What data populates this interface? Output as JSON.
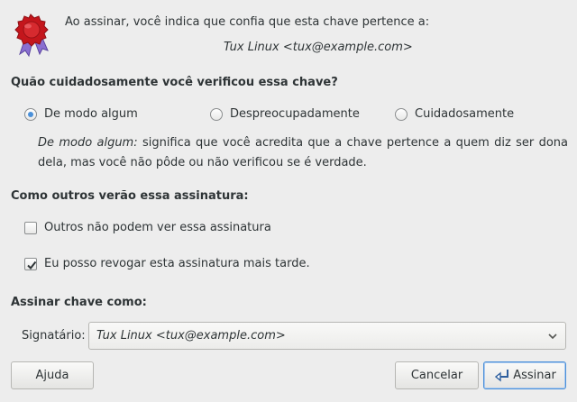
{
  "header": {
    "intro_text": "Ao assinar, você indica que confia que esta chave pertence a:",
    "key_owner": "Tux Linux <tux@example.com>"
  },
  "verification": {
    "heading": "Quão cuidadosamente você verificou essa chave?",
    "options": [
      {
        "label": "De modo algum",
        "selected": true
      },
      {
        "label": "Despreocupadamente",
        "selected": false
      },
      {
        "label": "Cuidadosamente",
        "selected": false
      }
    ],
    "description_term": "De modo algum:",
    "description_text": " significa que você acredita que a chave pertence a quem diz ser dona dela, mas você não pôde ou não verificou se é verdade."
  },
  "visibility": {
    "heading": "Como outros verão essa assinatura:",
    "options": [
      {
        "label": "Outros não podem ver essa assinatura",
        "checked": false
      },
      {
        "label": "Eu posso revogar esta assinatura mais tarde.",
        "checked": true
      }
    ]
  },
  "sign_as": {
    "heading": "Assinar chave como:",
    "signer_label": "Signatário:",
    "signer_value": "Tux Linux <tux@example.com>"
  },
  "buttons": {
    "help": "Ajuda",
    "cancel": "Cancelar",
    "sign": "Assinar"
  },
  "icons": {
    "seal": "seal-icon",
    "dropdown": "chevron-down-icon",
    "sign": "sign-icon"
  },
  "colors": {
    "accent": "#4a90d9",
    "seal_red": "#c4161c"
  }
}
